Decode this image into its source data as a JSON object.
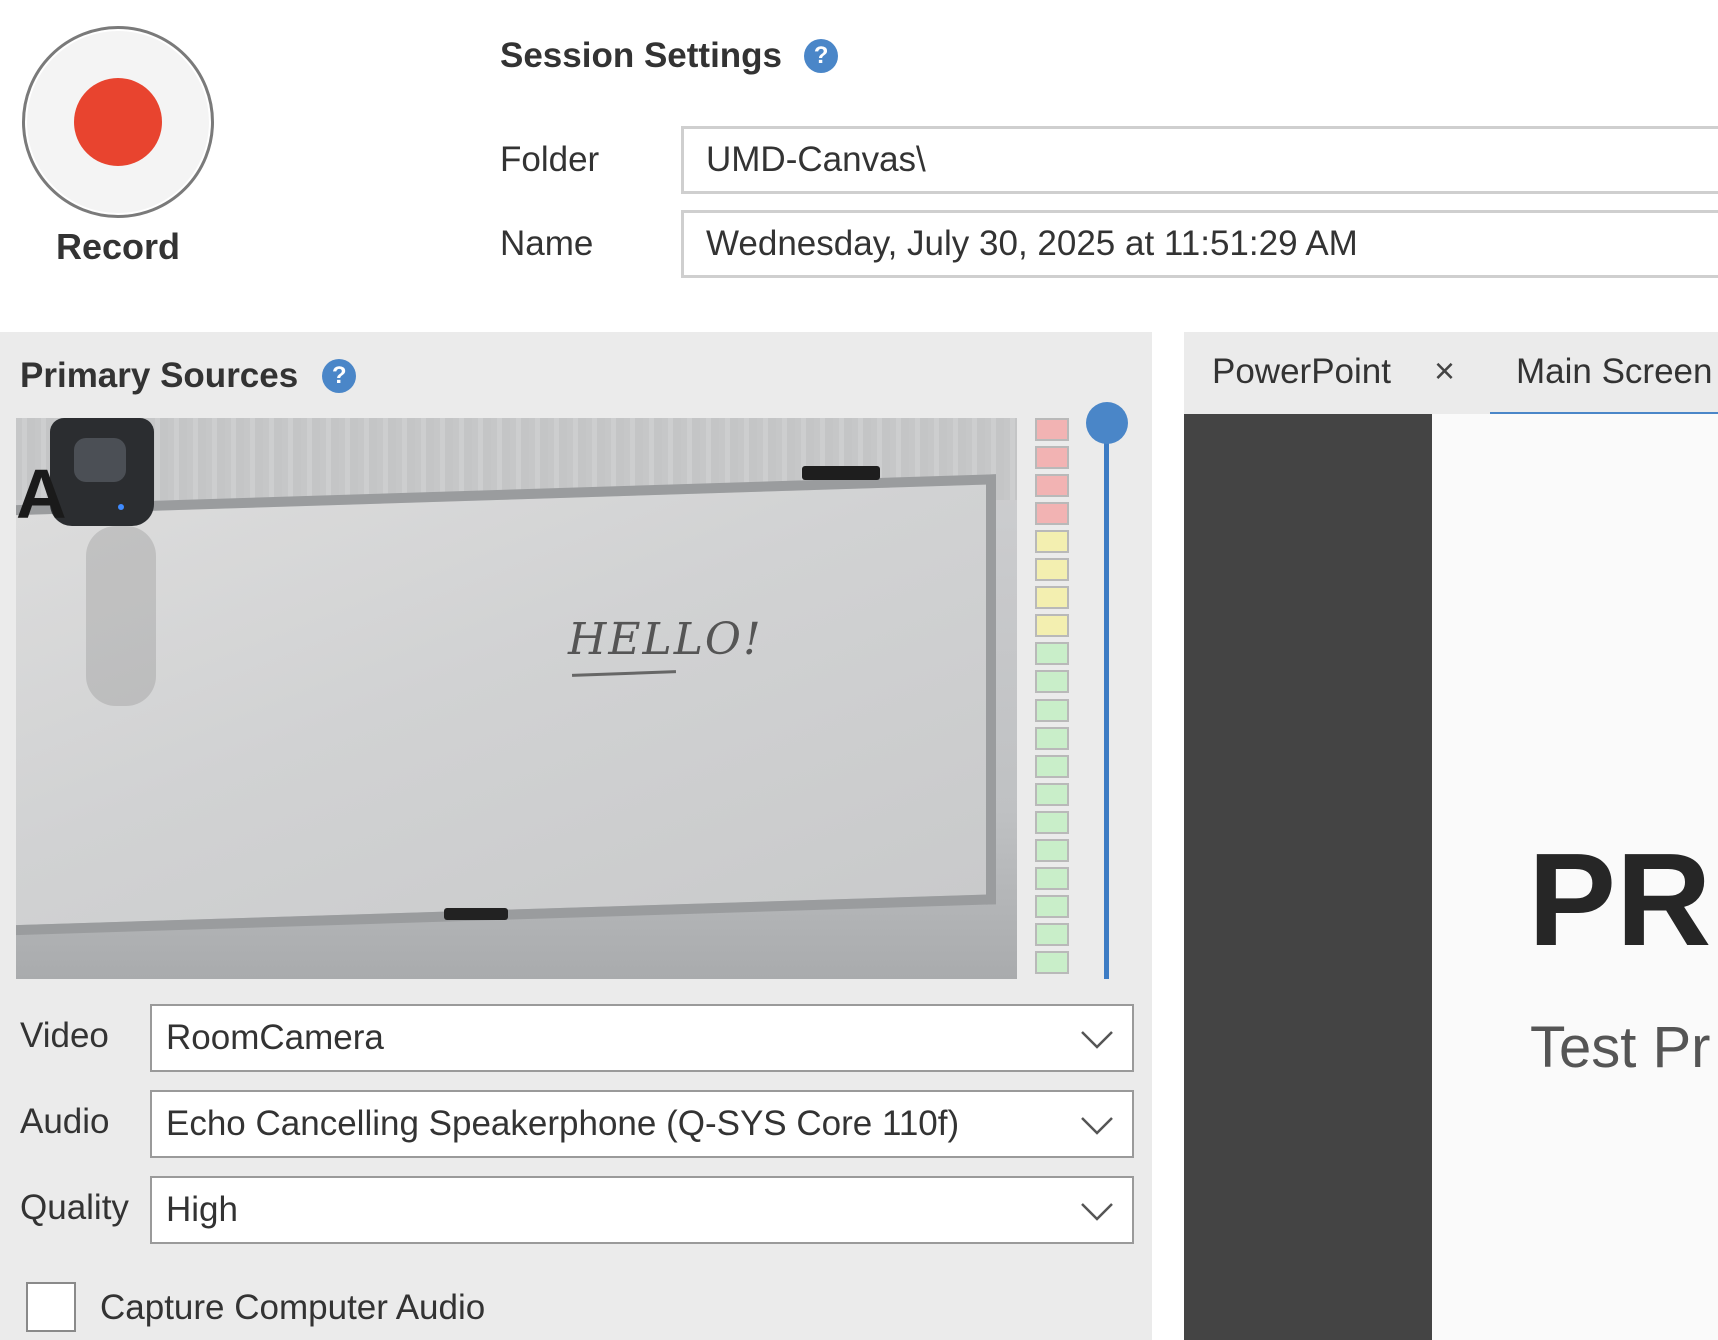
{
  "record": {
    "label": "Record",
    "accent": "#e8442f"
  },
  "session": {
    "title": "Session Settings",
    "help_glyph": "?",
    "folder": {
      "label": "Folder",
      "value": "UMD-Canvas\\"
    },
    "name": {
      "label": "Name",
      "value": "Wednesday, July 30, 2025 at 11:51:29 AM"
    }
  },
  "primary_sources": {
    "title": "Primary Sources",
    "help_glyph": "?",
    "preview_text": "HELLO!",
    "video": {
      "label": "Video",
      "value": "RoomCamera"
    },
    "audio": {
      "label": "Audio",
      "value": "Echo Cancelling Speakerphone (Q-SYS Core 110f)"
    },
    "quality": {
      "label": "Quality",
      "value": "High"
    },
    "capture_computer_audio": {
      "label": "Capture Computer Audio",
      "checked": false
    },
    "audio_meter": {
      "red": 4,
      "yellow": 4,
      "green": 12
    },
    "volume_level": 1.0
  },
  "secondary": {
    "tabs": [
      {
        "label": "PowerPoint",
        "active": false,
        "close_glyph": "×"
      },
      {
        "label": "Main Screen",
        "active": true
      }
    ],
    "slide": {
      "title": "PR",
      "subtitle": "Test Pr"
    }
  },
  "colors": {
    "accent_blue": "#4a86c8",
    "panel_bg": "#ebebeb",
    "dark_screen": "#444444"
  }
}
